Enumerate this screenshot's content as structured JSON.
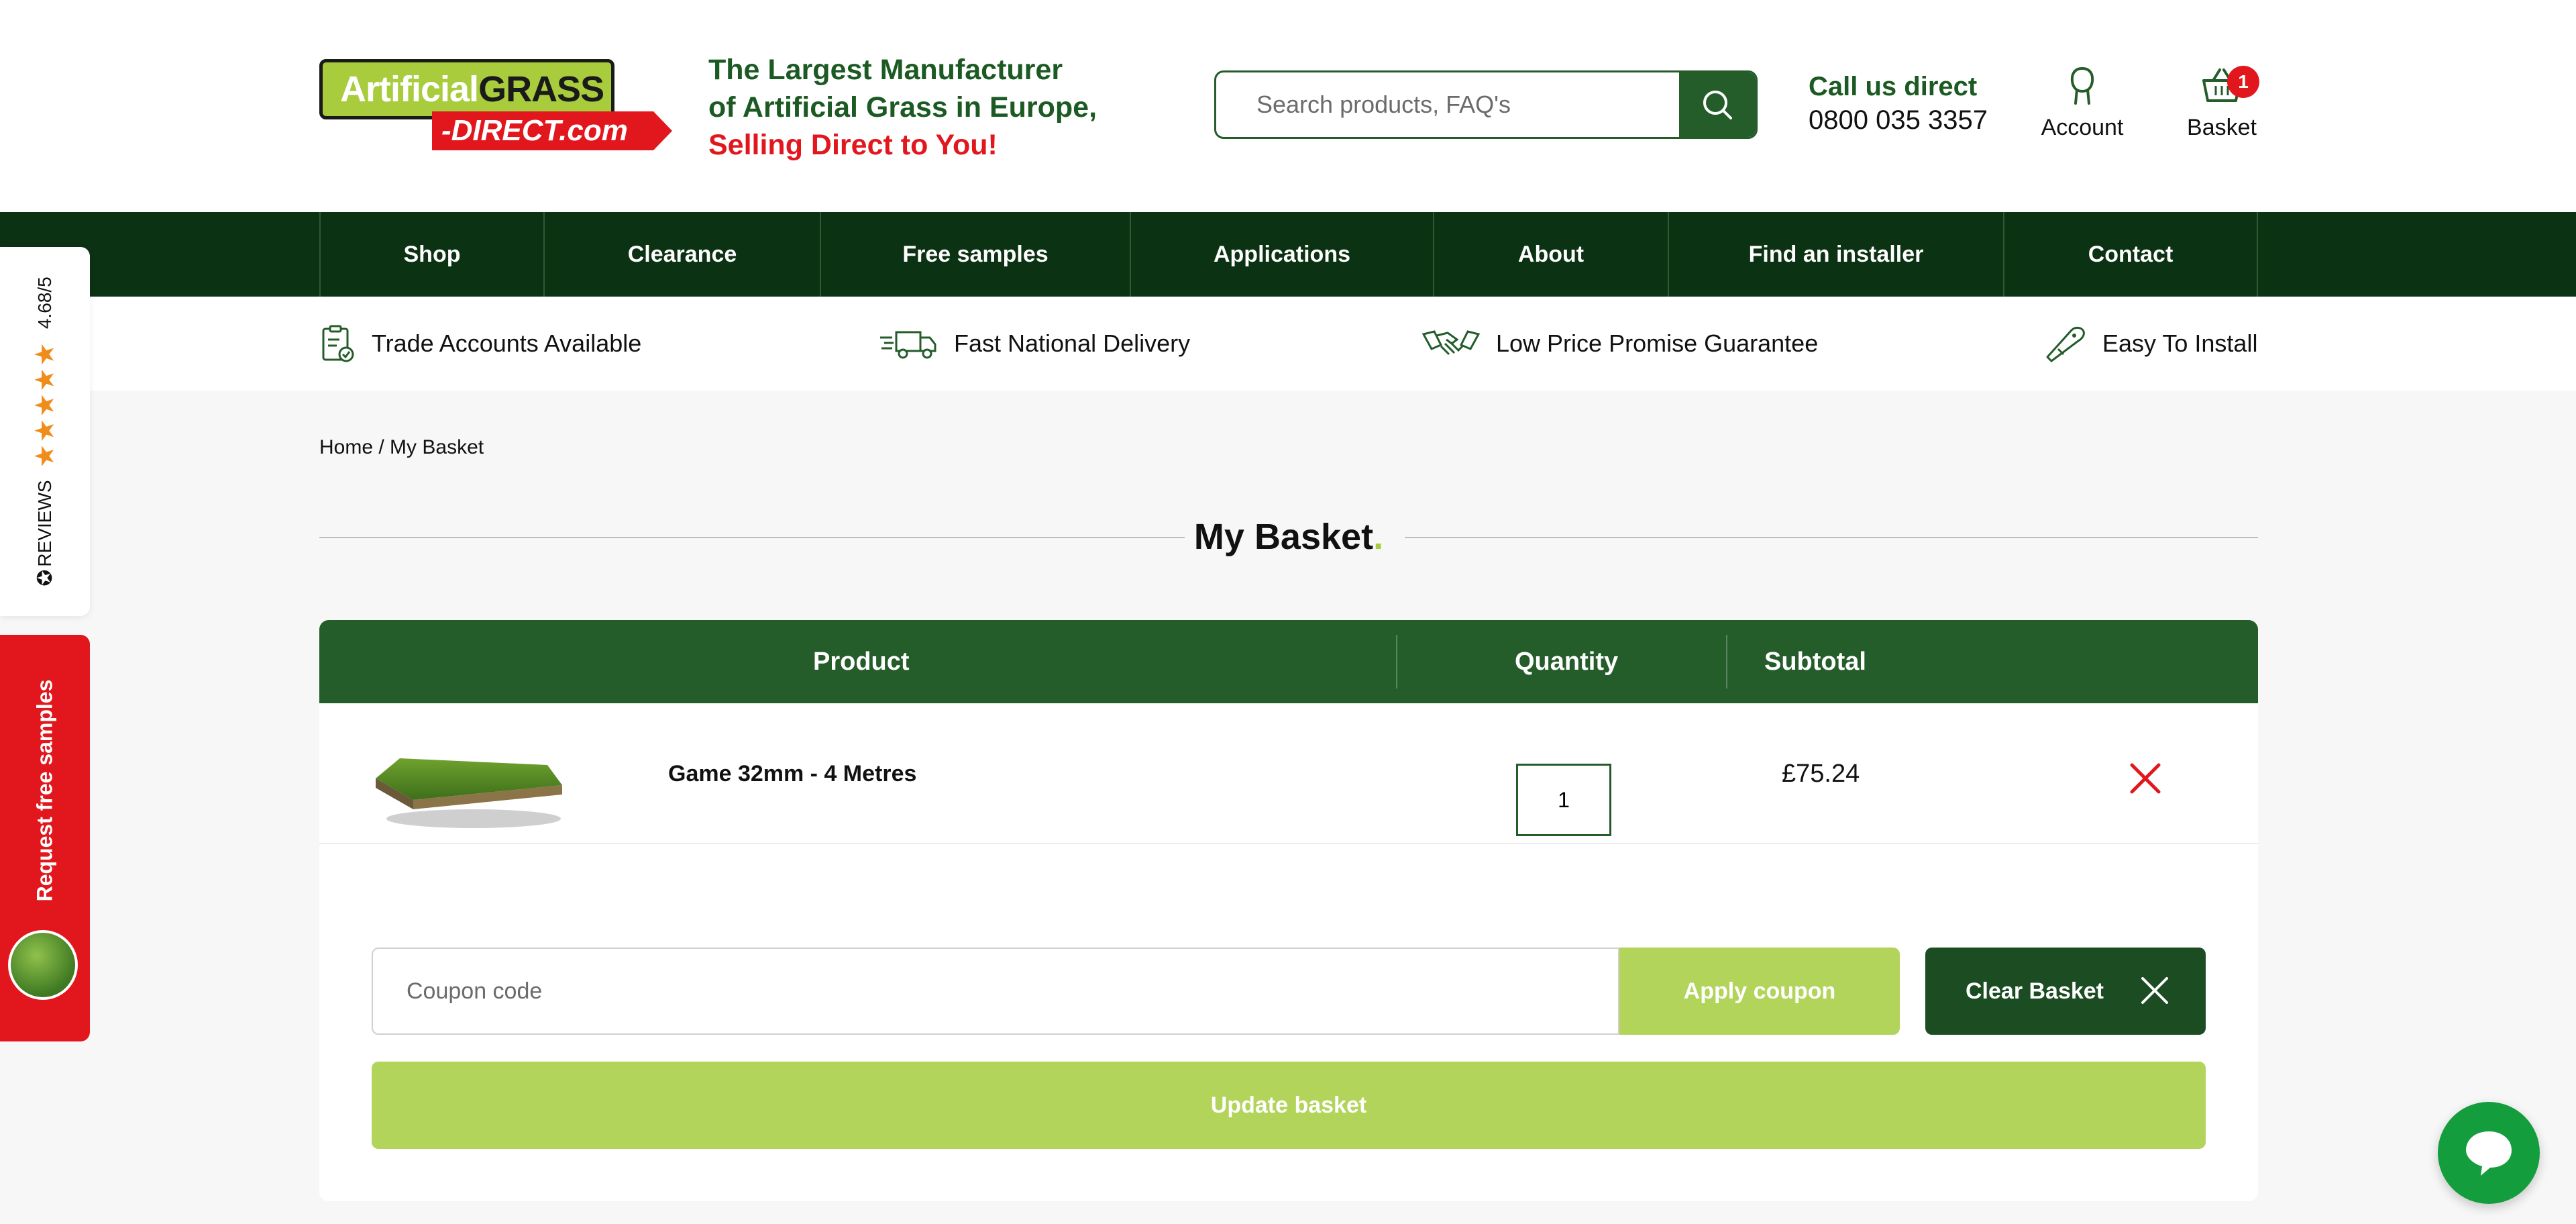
{
  "header": {
    "logo": {
      "line1_a": "Artificial",
      "line1_b": "GRASS",
      "line2": "-DIRECT.com"
    },
    "tagline": {
      "line1": "The Largest Manufacturer",
      "line2": "of Artificial Grass in Europe,",
      "line3": "Selling Direct to You!"
    },
    "search": {
      "placeholder": "Search products, FAQ's",
      "icon": "search-icon"
    },
    "call": {
      "label": "Call us direct",
      "number": "0800 035 3357"
    },
    "account": {
      "label": "Account",
      "icon": "user-icon"
    },
    "basket": {
      "label": "Basket",
      "count": "1",
      "icon": "basket-icon"
    }
  },
  "nav": {
    "items": [
      {
        "label": "Shop"
      },
      {
        "label": "Clearance"
      },
      {
        "label": "Free samples"
      },
      {
        "label": "Applications"
      },
      {
        "label": "About"
      },
      {
        "label": "Find an installer"
      },
      {
        "label": "Contact"
      }
    ]
  },
  "usp": {
    "items": [
      {
        "label": "Trade Accounts Available",
        "icon": "clipboard-check-icon"
      },
      {
        "label": "Fast National Delivery",
        "icon": "delivery-truck-icon"
      },
      {
        "label": "Low Price Promise Guarantee",
        "icon": "handshake-icon"
      },
      {
        "label": "Easy To Install",
        "icon": "utility-knife-icon"
      }
    ]
  },
  "side_tabs": {
    "reviews": {
      "brand": "REVIEWS",
      "rating": "4.68/5",
      "stars": 5
    },
    "samples": {
      "label": "Request free samples"
    }
  },
  "breadcrumb": {
    "home": "Home",
    "separator": " / ",
    "current": "My Basket"
  },
  "page_title": {
    "text": "My Basket",
    "dot": "."
  },
  "table": {
    "headers": {
      "product": "Product",
      "quantity": "Quantity",
      "subtotal": "Subtotal"
    },
    "rows": [
      {
        "name": "Game 32mm - 4 Metres",
        "quantity": "1",
        "subtotal": "£75.24"
      }
    ]
  },
  "actions": {
    "coupon_placeholder": "Coupon code",
    "apply_label": "Apply coupon",
    "clear_label": "Clear Basket",
    "update_label": "Update basket"
  },
  "colors": {
    "brand_green": "#245c2a",
    "nav_green": "#0b3212",
    "lime": "#b2d45a",
    "red": "#e2171e",
    "chat_green": "#149d3d"
  }
}
